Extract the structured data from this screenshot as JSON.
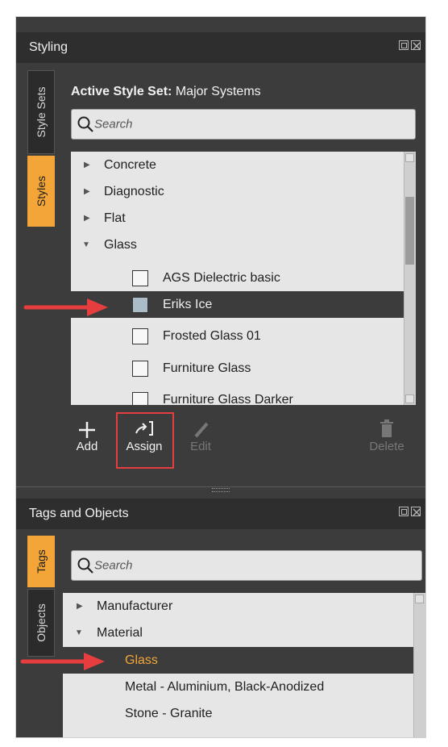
{
  "styling": {
    "title": "Styling",
    "tabs": [
      "Style Sets",
      "Styles"
    ],
    "active_style_set_label": "Active Style Set:",
    "active_style_set_value": "Major Systems",
    "search_placeholder": "Search",
    "categories": [
      {
        "label": "Concrete",
        "expanded": false
      },
      {
        "label": "Diagnostic",
        "expanded": false
      },
      {
        "label": "Flat",
        "expanded": false
      },
      {
        "label": "Glass",
        "expanded": true
      }
    ],
    "glass_items": [
      "AGS Dielectric basic",
      "Eriks Ice",
      "Frosted Glass 01",
      "Furniture Glass",
      "Furniture Glass Darker"
    ],
    "selected_item": "Eriks Ice",
    "selected_swatch_color": "#a9bcc7",
    "toolbar": {
      "add": "Add",
      "assign": "Assign",
      "edit": "Edit",
      "delete": "Delete"
    }
  },
  "tags": {
    "title": "Tags and Objects",
    "tabs": [
      "Tags",
      "Objects"
    ],
    "search_placeholder": "Search",
    "tree": [
      {
        "label": "Manufacturer",
        "expanded": false
      },
      {
        "label": "Material",
        "expanded": true
      }
    ],
    "material_children": [
      "Glass",
      "Metal - Aluminium, Black-Anodized",
      "Stone - Granite"
    ],
    "selected_child": "Glass"
  },
  "colors": {
    "accent": "#f3a537",
    "highlight_red": "#e63e3e",
    "panel_bg": "#3c3c3c"
  }
}
